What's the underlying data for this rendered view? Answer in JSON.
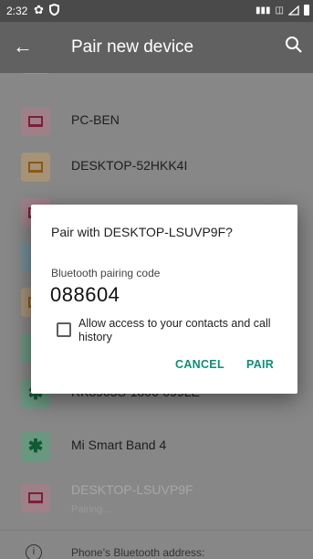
{
  "status_bar": {
    "time": "2:32"
  },
  "app_bar": {
    "title": "Pair new device"
  },
  "devices": [
    {
      "name": "PC-BEN",
      "icon": "laptop-icon"
    },
    {
      "name": "DESKTOP-52HKK4I",
      "icon": "laptop-icon"
    },
    {
      "name": "RK8903S-1806-099LE",
      "icon": "bluetooth-icon"
    },
    {
      "name": "Mi Smart Band 4",
      "icon": "bluetooth-icon"
    },
    {
      "name": "DESKTOP-LSUVP9F",
      "status": "Pairing...",
      "icon": "laptop-icon"
    }
  ],
  "footer": {
    "text": "Phone's Bluetooth address:"
  },
  "dialog": {
    "title": "Pair with DESKTOP-LSUVP9F?",
    "code_label": "Bluetooth pairing code",
    "code": "088604",
    "checkbox_label": "Allow access to your contacts and call history",
    "cancel_label": "CANCEL",
    "pair_label": "PAIR"
  },
  "colors": {
    "accent": "#0c8f76",
    "app_bar": "#616161",
    "status_bar": "#4a4a4a"
  }
}
